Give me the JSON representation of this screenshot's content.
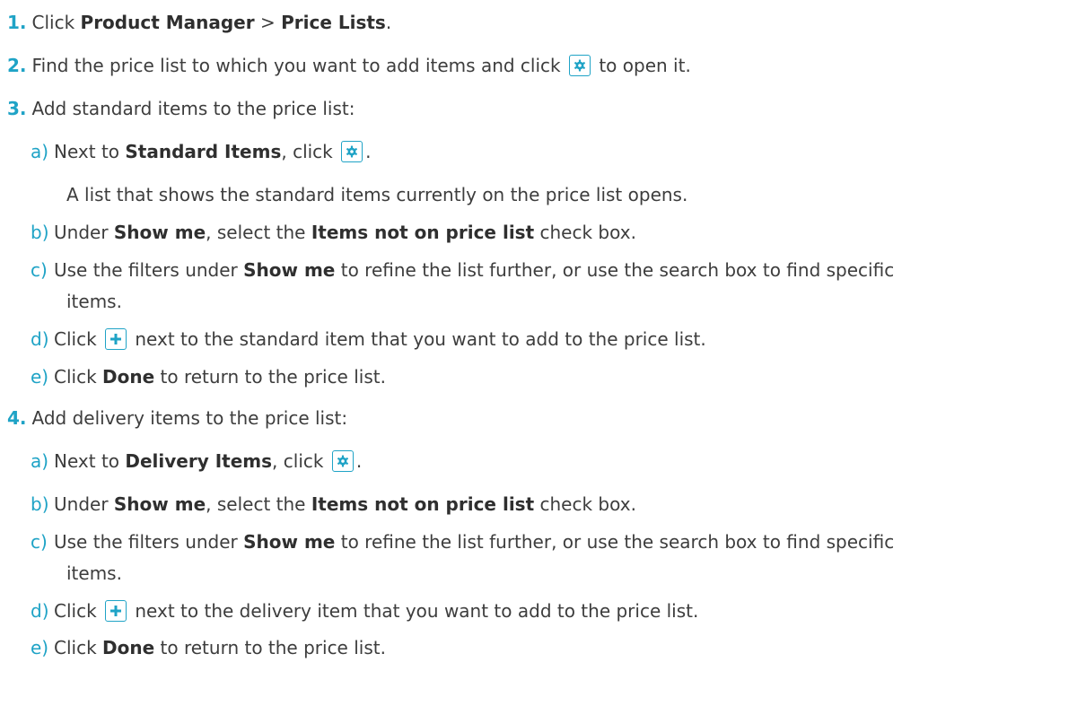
{
  "steps": [
    {
      "num": "1.",
      "t1": "Click ",
      "b1": "Product Manager",
      "t2": " > ",
      "b2": "Price Lists",
      "t3": "."
    },
    {
      "num": "2.",
      "t1": "Find the price list to which you want to add items and click",
      "icon": "gear-icon",
      "t2": "to open it."
    },
    {
      "num": "3.",
      "t1": "Add standard items to the price list:",
      "subs": [
        {
          "letter": "a)",
          "t1": "Next to ",
          "b1": "Standard Items",
          "t2": ", click",
          "icon": "gear-icon",
          "t3": "."
        },
        {
          "text": "A list that shows the standard items currently on the price list opens."
        },
        {
          "letter": "b)",
          "t1": "Under ",
          "b1": "Show me",
          "t2": ", select the ",
          "b2": "Items not on price list",
          "t3": " check box."
        },
        {
          "letter": "c)",
          "t1": "Use the filters under ",
          "b1": "Show me",
          "t2": " to refine the list further, or use the search box to find specific",
          "t3": "items."
        },
        {
          "letter": "d)",
          "t1": "Click",
          "icon": "plus-icon",
          "t2": "next to the standard item that you want to add to the price list."
        },
        {
          "letter": "e)",
          "t1": "Click ",
          "b1": "Done",
          "t2": " to return to the price list."
        }
      ]
    },
    {
      "num": "4.",
      "t1": "Add delivery items to the price list:",
      "subs": [
        {
          "letter": "a)",
          "t1": "Next to ",
          "b1": "Delivery Items",
          "t2": ", click",
          "icon": "gear-icon",
          "t3": "."
        },
        {
          "letter": "b)",
          "t1": "Under ",
          "b1": "Show me",
          "t2": ", select the ",
          "b2": "Items not on price list",
          "t3": " check box."
        },
        {
          "letter": "c)",
          "t1": "Use the filters under ",
          "b1": "Show me",
          "t2": " to refine the list further, or use the search box to find specific",
          "t3": "items."
        },
        {
          "letter": "d)",
          "t1": "Click",
          "icon": "plus-icon",
          "t2": "next to the delivery item that you want to add to the price list."
        },
        {
          "letter": "e)",
          "t1": "Click ",
          "b1": "Done",
          "t2": " to return to the price list."
        }
      ]
    }
  ],
  "colors": {
    "accent": "#1fa3c6",
    "text": "#3d3d3d"
  }
}
